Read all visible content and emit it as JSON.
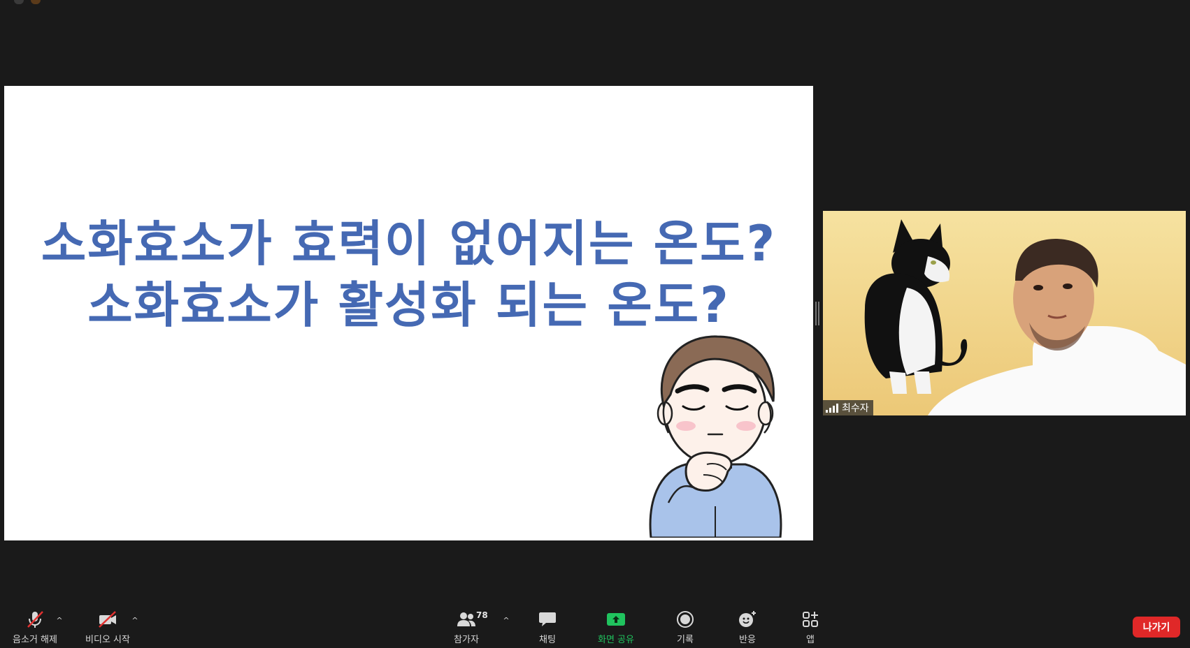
{
  "slide": {
    "line1": "소화효소가 효력이 없어지는 온도?",
    "line2": "소화효소가 활성화 되는 온도?"
  },
  "video": {
    "participant_name": "최수자"
  },
  "toolbar": {
    "mute_label": "음소거 해제",
    "video_label": "비디오 시작",
    "participants_label": "참가자",
    "participants_count": "78",
    "chat_label": "채팅",
    "share_label": "화면 공유",
    "record_label": "기록",
    "reactions_label": "반응",
    "apps_label": "앱",
    "leave_label": "나가기"
  },
  "colors": {
    "slide_text": "#4569b3",
    "share_green": "#20c35e",
    "leave_red": "#e02828",
    "background": "#1a1a1a"
  }
}
